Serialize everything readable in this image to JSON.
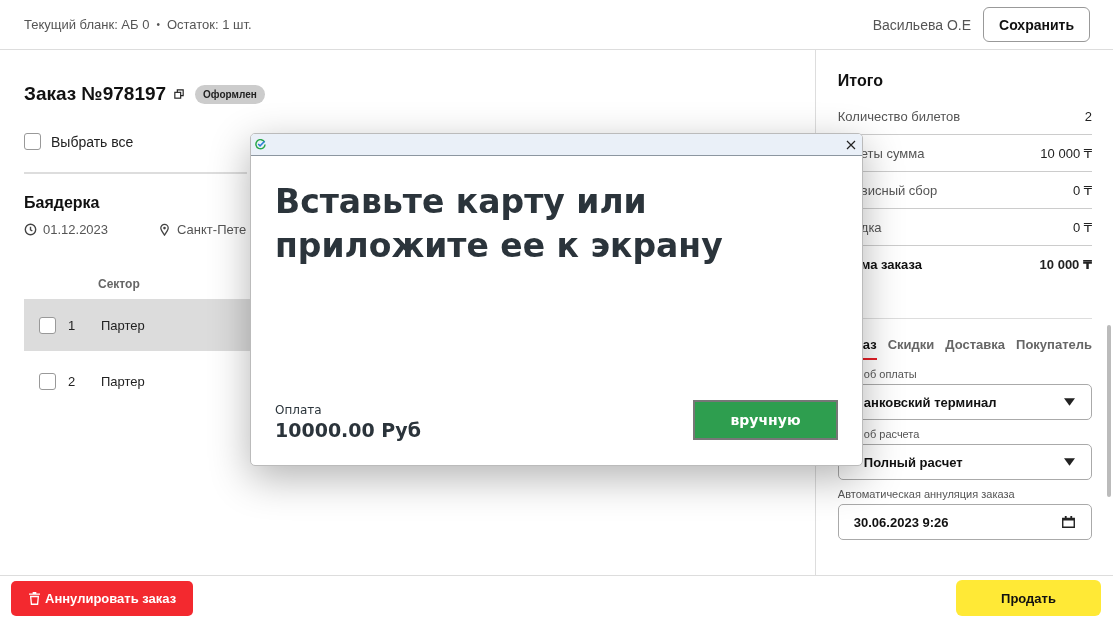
{
  "header": {
    "blank_info": "Текущий бланк: АБ 0",
    "separator": "•",
    "remaining": "Остаток: 1 шт.",
    "user": "Васильева О.Е",
    "save_button": "Сохранить"
  },
  "order": {
    "title": "Заказ №978197",
    "status": "Оформлен",
    "select_all": {
      "label": "Выбрать все",
      "checked": false
    }
  },
  "event": {
    "title": "Баядерка",
    "date": "01.12.2023",
    "venue": "Санкт-Пете"
  },
  "table": {
    "columns": [
      "Сектор"
    ],
    "rows": [
      {
        "number": "1",
        "sector": "Партер",
        "checked": false,
        "selected": true
      },
      {
        "number": "2",
        "sector": "Партер",
        "checked": false,
        "selected": false
      }
    ]
  },
  "summary": {
    "title": "Итого",
    "rows": [
      {
        "label": "Количество билетов",
        "value": "2",
        "kind": "normal"
      },
      {
        "label": "еты сумма",
        "value": "10 000 ₸",
        "kind": "normal"
      },
      {
        "label": "висный сбор",
        "value": "0 ₸",
        "kind": "normal"
      },
      {
        "label": "дка",
        "value": "0 ₸",
        "kind": "normal"
      },
      {
        "label": "ма заказа",
        "value": "10 000 ₸",
        "kind": "total"
      }
    ]
  },
  "tabs": [
    {
      "label": "аз",
      "selected": true
    },
    {
      "label": "Скидки",
      "selected": false
    },
    {
      "label": "Доставка",
      "selected": false
    },
    {
      "label": "Покупатель",
      "selected": false
    }
  ],
  "form": {
    "fields": [
      {
        "label": "об оплаты",
        "value": "анковский терминал",
        "kind": "select"
      },
      {
        "label": "об расчета",
        "value": "Полный расчет",
        "kind": "select"
      },
      {
        "label": "Автоматическая аннуляция заказа",
        "value": "30.06.2023 9:26",
        "kind": "date"
      }
    ]
  },
  "footer": {
    "cancel_button": "Аннулировать заказ",
    "sell_button": "Продать"
  },
  "dialog": {
    "message": "Вставьте карту или приложите ее к экрану",
    "payment_label": "Оплата",
    "amount": "10000.00 Руб",
    "manual_button": "вручную"
  }
}
